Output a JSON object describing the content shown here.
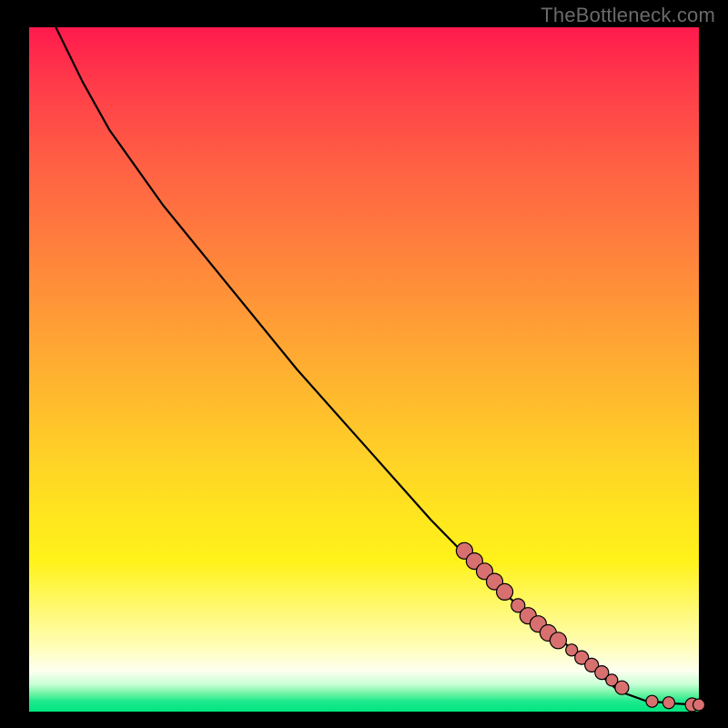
{
  "watermark": "TheBottleneck.com",
  "colors": {
    "dot_fill": "#d87070",
    "curve_stroke": "#000000"
  },
  "chart_data": {
    "type": "line",
    "title": "",
    "xlabel": "",
    "ylabel": "",
    "xlim": [
      0,
      100
    ],
    "ylim": [
      0,
      100
    ],
    "grid": false,
    "curve_note": "Monotone decreasing bottleneck curve; starts near top-left (~x=4,y=100), slight convex bend around x≈10, then near-linear descent to ~x=90,y≈2, then levels to y≈1 at x=100.",
    "curve_points": [
      {
        "x": 4,
        "y": 100
      },
      {
        "x": 8,
        "y": 92
      },
      {
        "x": 12,
        "y": 85
      },
      {
        "x": 20,
        "y": 74
      },
      {
        "x": 30,
        "y": 62
      },
      {
        "x": 40,
        "y": 50
      },
      {
        "x": 50,
        "y": 39
      },
      {
        "x": 60,
        "y": 28
      },
      {
        "x": 70,
        "y": 18
      },
      {
        "x": 80,
        "y": 10
      },
      {
        "x": 88,
        "y": 3
      },
      {
        "x": 92,
        "y": 1.6
      },
      {
        "x": 96,
        "y": 1.2
      },
      {
        "x": 100,
        "y": 1.0
      }
    ],
    "markers_note": "Salmon circular markers clustered along lower-right of curve (≈x 65–100).",
    "markers": [
      {
        "x": 65,
        "y": 23.5,
        "size": "big"
      },
      {
        "x": 66.5,
        "y": 22,
        "size": "big"
      },
      {
        "x": 68,
        "y": 20.5,
        "size": "big"
      },
      {
        "x": 69.5,
        "y": 19,
        "size": "big"
      },
      {
        "x": 71,
        "y": 17.5,
        "size": "big"
      },
      {
        "x": 73,
        "y": 15.5,
        "size": "mid"
      },
      {
        "x": 74.5,
        "y": 14,
        "size": "big"
      },
      {
        "x": 76,
        "y": 12.8,
        "size": "big"
      },
      {
        "x": 77.5,
        "y": 11.5,
        "size": "big"
      },
      {
        "x": 79,
        "y": 10.4,
        "size": "big"
      },
      {
        "x": 81,
        "y": 9,
        "size": "sm"
      },
      {
        "x": 82.5,
        "y": 7.9,
        "size": "mid"
      },
      {
        "x": 84,
        "y": 6.8,
        "size": "mid"
      },
      {
        "x": 85.5,
        "y": 5.7,
        "size": "mid"
      },
      {
        "x": 87,
        "y": 4.6,
        "size": "sm"
      },
      {
        "x": 88.5,
        "y": 3.5,
        "size": "mid"
      },
      {
        "x": 93,
        "y": 1.5,
        "size": "sm"
      },
      {
        "x": 95.5,
        "y": 1.3,
        "size": "sm"
      },
      {
        "x": 99,
        "y": 1.0,
        "size": "mid"
      },
      {
        "x": 100,
        "y": 1.0,
        "size": "sm"
      }
    ]
  }
}
